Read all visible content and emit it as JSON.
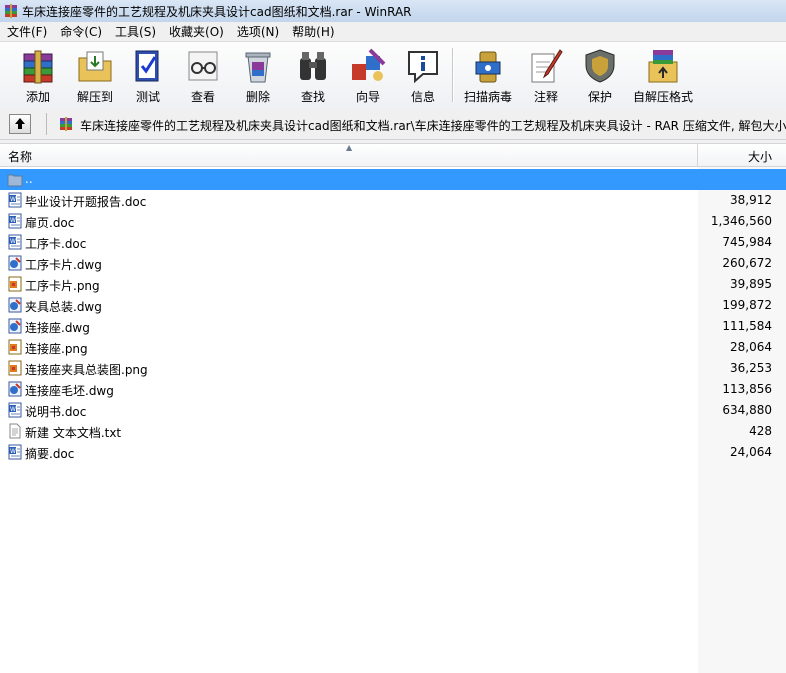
{
  "window": {
    "title": "车床连接座零件的工艺规程及机床夹具设计cad图纸和文档.rar - WinRAR"
  },
  "menu": [
    {
      "label": "文件(F)"
    },
    {
      "label": "命令(C)"
    },
    {
      "label": "工具(S)"
    },
    {
      "label": "收藏夹(O)"
    },
    {
      "label": "选项(N)"
    },
    {
      "label": "帮助(H)"
    }
  ],
  "toolbar": [
    {
      "label": "添加",
      "icon": "add-books-icon"
    },
    {
      "label": "解压到",
      "icon": "extract-folder-icon"
    },
    {
      "label": "测试",
      "icon": "test-check-icon"
    },
    {
      "label": "查看",
      "icon": "view-glasses-icon"
    },
    {
      "label": "删除",
      "icon": "delete-recycle-icon"
    },
    {
      "label": "查找",
      "icon": "find-binoculars-icon"
    },
    {
      "label": "向导",
      "icon": "wizard-icon"
    },
    {
      "label": "信息",
      "icon": "info-icon"
    },
    {
      "label": "扫描病毒",
      "icon": "virus-scan-icon"
    },
    {
      "label": "注释",
      "icon": "comment-pen-icon"
    },
    {
      "label": "保护",
      "icon": "protect-shield-icon"
    },
    {
      "label": "自解压格式",
      "icon": "sfx-archive-icon"
    }
  ],
  "address": {
    "path": "车床连接座零件的工艺规程及机床夹具设计cad图纸和文档.rar\\车床连接座零件的工艺规程及机床夹具设计 - RAR 压缩文件, 解包大小"
  },
  "list": {
    "columns": {
      "name": "名称",
      "size": "大小"
    },
    "rows": [
      {
        "name": "..",
        "size": "",
        "type": "parent",
        "selected": true
      },
      {
        "name": "毕业设计开题报告.doc",
        "size": "38,912",
        "type": "doc"
      },
      {
        "name": "扉页.doc",
        "size": "1,346,560",
        "type": "doc"
      },
      {
        "name": "工序卡.doc",
        "size": "745,984",
        "type": "doc"
      },
      {
        "name": "工序卡片.dwg",
        "size": "260,672",
        "type": "dwg"
      },
      {
        "name": "工序卡片.png",
        "size": "39,895",
        "type": "png"
      },
      {
        "name": "夹具总装.dwg",
        "size": "199,872",
        "type": "dwg"
      },
      {
        "name": "连接座.dwg",
        "size": "111,584",
        "type": "dwg"
      },
      {
        "name": "连接座.png",
        "size": "28,064",
        "type": "png"
      },
      {
        "name": "连接座夹具总装图.png",
        "size": "36,253",
        "type": "png"
      },
      {
        "name": "连接座毛坯.dwg",
        "size": "113,856",
        "type": "dwg"
      },
      {
        "name": "说明书.doc",
        "size": "634,880",
        "type": "doc"
      },
      {
        "name": "新建 文本文档.txt",
        "size": "428",
        "type": "txt"
      },
      {
        "name": "摘要.doc",
        "size": "24,064",
        "type": "doc"
      }
    ]
  },
  "colors": {
    "selection": "#3399ff",
    "titlebar": "#c2d5ec"
  }
}
